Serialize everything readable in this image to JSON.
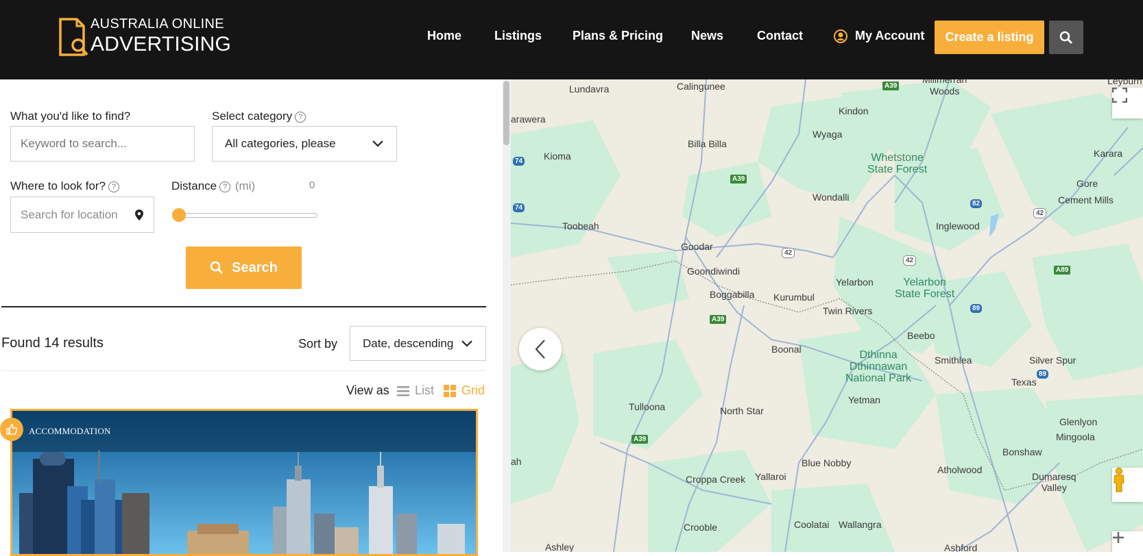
{
  "brand": {
    "line1": "AUSTRALIA ONLINE",
    "line2": "ADVERTISING",
    "accent": "#f8ae3b"
  },
  "nav": {
    "home": "Home",
    "listings": "Listings",
    "plans": "Plans & Pricing",
    "news": "News",
    "contact": "Contact",
    "account": "My Account"
  },
  "header": {
    "create_label": "Create a listing"
  },
  "filters": {
    "find_label": "What you'd like to find?",
    "keyword_placeholder": "Keyword to search...",
    "category_label": "Select category",
    "category_value": "All categories, please",
    "location_label": "Where to look for?",
    "location_placeholder": "Search for location",
    "distance_label": "Distance",
    "distance_unit": "(mi)",
    "distance_value": "0",
    "search_label": "Search"
  },
  "results": {
    "count_text": "Found 14 results",
    "sort_label": "Sort by",
    "sort_value": "Date, descending",
    "view_label": "View as",
    "view_list": "List",
    "view_grid": "Grid"
  },
  "listing": {
    "category": "ACCOMMODATION"
  },
  "map": {
    "places": [
      "Lundavra",
      "Calingunee",
      "Millmerran Woods",
      "Leyburn",
      "arawera",
      "Kindon",
      "Kioma",
      "Billa Billa",
      "Wyaga",
      "Whetstone State Forest",
      "Karara",
      "Gore",
      "Cement Mills",
      "Wondalli",
      "Inglewood",
      "Toobeah",
      "Goodar",
      "Goondiwindi",
      "Yelarbon",
      "Yelarbon State Forest",
      "Boggabilla",
      "Kurumbul",
      "Twin Rivers",
      "Beebo",
      "Boonal",
      "Dthinna Dthinnawan National Park",
      "Smithlea",
      "Silver Spur",
      "Texas",
      "Yetman",
      "Tulloona",
      "North Star",
      "Glenlyon",
      "Mingoola",
      "Bonshaw",
      "ah",
      "Blue Nobby",
      "Atholwood",
      "Croppa Creek",
      "Yallaroi",
      "Dumaresq Valley",
      "Crooble",
      "Coolatai",
      "Wallangra",
      "Ashley",
      "Ashford"
    ],
    "routes": [
      "A39",
      "74",
      "82",
      "42",
      "89",
      "A89"
    ]
  }
}
